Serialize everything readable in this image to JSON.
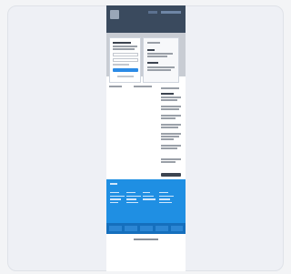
{
  "colors": {
    "card_bg": "#eef0f5",
    "page_bg": "#ffffff",
    "header_bg": "#3a4a5e",
    "footer_bg": "#1f8fe3",
    "footer_bottom_bg": "#156fbd",
    "accent_button": "#2b8be6"
  },
  "preview": {
    "icons": [
      "logo-icon"
    ]
  }
}
